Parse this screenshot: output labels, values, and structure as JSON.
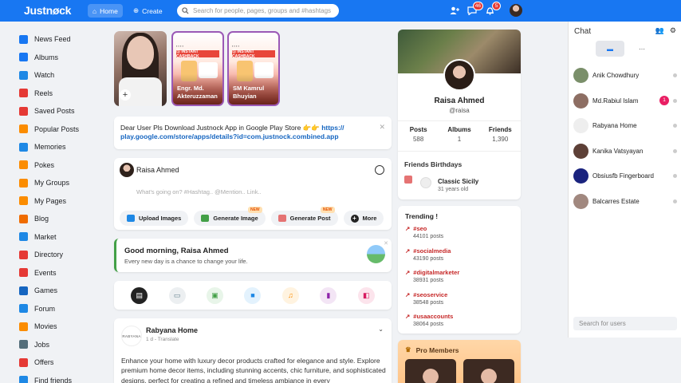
{
  "topbar": {
    "logo": "Justnøck",
    "home_label": "Home",
    "create_label": "Create",
    "search_placeholder": "Search for people, pages, groups and #hashtags",
    "friend_requests_badge": "46",
    "messages_badge": "5",
    "accent": "#1877f2"
  },
  "sidebar": {
    "items": [
      {
        "label": "News Feed",
        "icon": "home-icon",
        "color": "#1877f2"
      },
      {
        "label": "Albums",
        "icon": "album-icon",
        "color": "#1877f2"
      },
      {
        "label": "Watch",
        "icon": "video-icon",
        "color": "#1e88e5"
      },
      {
        "label": "Reels",
        "icon": "reels-icon",
        "color": "#e53935"
      },
      {
        "label": "Saved Posts",
        "icon": "bookmark-icon",
        "color": "#e53935"
      },
      {
        "label": "Popular Posts",
        "icon": "fire-icon",
        "color": "#fb8c00"
      },
      {
        "label": "Memories",
        "icon": "memories-icon",
        "color": "#1e88e5"
      },
      {
        "label": "Pokes",
        "icon": "hand-icon",
        "color": "#fb8c00"
      },
      {
        "label": "My Groups",
        "icon": "group-icon",
        "color": "#fb8c00"
      },
      {
        "label": "My Pages",
        "icon": "flag-icon",
        "color": "#fb8c00"
      },
      {
        "label": "Blog",
        "icon": "blog-icon",
        "color": "#ef6c00"
      },
      {
        "label": "Market",
        "icon": "market-icon",
        "color": "#1e88e5"
      },
      {
        "label": "Directory",
        "icon": "directory-icon",
        "color": "#e53935"
      },
      {
        "label": "Events",
        "icon": "calendar-icon",
        "color": "#e53935"
      },
      {
        "label": "Games",
        "icon": "gamepad-icon",
        "color": "#1565c0"
      },
      {
        "label": "Forum",
        "icon": "forum-icon",
        "color": "#1e88e5"
      },
      {
        "label": "Movies",
        "icon": "movie-icon",
        "color": "#fb8c00"
      },
      {
        "label": "Jobs",
        "icon": "briefcase-icon",
        "color": "#546e7a"
      },
      {
        "label": "Offers",
        "icon": "offer-icon",
        "color": "#e53935"
      },
      {
        "label": "Find friends",
        "icon": "find-friends-icon",
        "color": "#1e88e5"
      }
    ]
  },
  "stories": [
    {
      "name": "Engr Md Akteruzzaman",
      "display": "Engr. Md.\nAkteruzzaman",
      "promo": "Ⓢ INSTANT CASHBACK"
    },
    {
      "name": "SM Kamrul Bhuyian",
      "display": "SM Kamrul\nBhuyian",
      "promo": "Ⓢ INSTANT CASHBACK"
    }
  ],
  "notice": {
    "text": "Dear User Pls Download Justnock App in Google Play Store 👉👉 ",
    "link": "https://play.google.com/store/apps/details?id=com.justnock.combined.app",
    "link_line1": "https://",
    "link_line2": "play.google.com/store/apps/details?id=com.justnock.combined.app"
  },
  "composer": {
    "user": "Raisa Ahmed",
    "placeholder": "What's going on? #Hashtag.. @Mention.. Link..",
    "actions": [
      {
        "label": "Upload Images",
        "icon": "image-icon",
        "new": ""
      },
      {
        "label": "Generate Image",
        "icon": "ai-image-icon",
        "new": "NEW"
      },
      {
        "label": "Generate Post",
        "icon": "ai-post-icon",
        "new": "NEW"
      },
      {
        "label": "More",
        "icon": "plus-circle-icon",
        "new": ""
      }
    ],
    "new_badge": "NEW"
  },
  "greeting": {
    "title": "Good morning, Raisa Ahmed",
    "subtitle": "Every new day is a chance to change your life."
  },
  "post": {
    "page_name": "Rabyana Home",
    "avatar_text": "RABYANA",
    "meta": "1 d - Translate",
    "text": "Enhance your home with luxury decor products crafted for elegance and style. Explore premium home decor items, including stunning accents, chic furniture, and sophisticated designs, perfect for creating a refined and timeless ambiance in every"
  },
  "profile": {
    "name": "Raisa Ahmed",
    "handle": "@raisa",
    "stats": [
      {
        "label": "Posts",
        "value": "588"
      },
      {
        "label": "Albums",
        "value": "1"
      },
      {
        "label": "Friends",
        "value": "1,390"
      }
    ],
    "birthdays_title": "Friends Birthdays",
    "birthday_name": "Classic Sicily",
    "birthday_age": "31 years old"
  },
  "trending": {
    "title": "Trending !",
    "items": [
      {
        "tag": "#seo",
        "count": "44101 posts"
      },
      {
        "tag": "#socialmedia",
        "count": "43190 posts"
      },
      {
        "tag": "#digitalmarketer",
        "count": "38931 posts"
      },
      {
        "tag": "#seoservice",
        "count": "38548 posts"
      },
      {
        "tag": "#usaaccounts",
        "count": "38064 posts"
      }
    ]
  },
  "pro_members": {
    "title": "Pro Members"
  },
  "chat": {
    "title": "Chat",
    "search_placeholder": "Search for users",
    "contacts": [
      {
        "name": "Anik Chowdhury",
        "unread": ""
      },
      {
        "name": "Md.Rabiul Islam",
        "unread": "1"
      },
      {
        "name": "Rabyana Home",
        "unread": ""
      },
      {
        "name": "Kanika Vatsyayan",
        "unread": ""
      },
      {
        "name": "Obsiusfb Fingerboard",
        "unread": ""
      },
      {
        "name": "Balcarres Estate",
        "unread": ""
      }
    ]
  }
}
